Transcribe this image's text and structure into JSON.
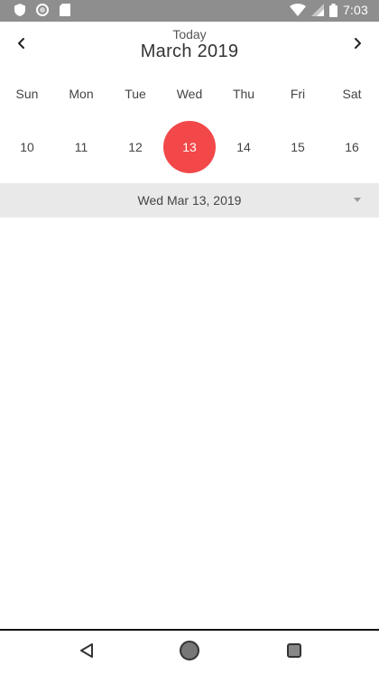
{
  "status_bar": {
    "time": "7:03",
    "icons": [
      "shield-icon",
      "circle-icon",
      "sd-card-icon",
      "wifi-icon",
      "signal-icon",
      "battery-icon"
    ],
    "bg_color": "#8e8e8e"
  },
  "header": {
    "today_label": "Today",
    "month_title": "March 2019",
    "prev_icon": "chevron-left-icon",
    "next_icon": "chevron-right-icon"
  },
  "weekdays": [
    "Sun",
    "Mon",
    "Tue",
    "Wed",
    "Thu",
    "Fri",
    "Sat"
  ],
  "dates": [
    "10",
    "11",
    "12",
    "13",
    "14",
    "15",
    "16"
  ],
  "selected_date": "13",
  "accent_color": "#f2484a",
  "date_bar": {
    "label": "Wed Mar 13, 2019",
    "icon": "dropdown-arrow-icon",
    "bg_color": "#e9e9e9"
  },
  "nav_bar": {
    "icons": [
      "back-icon",
      "home-icon",
      "recents-icon"
    ]
  }
}
